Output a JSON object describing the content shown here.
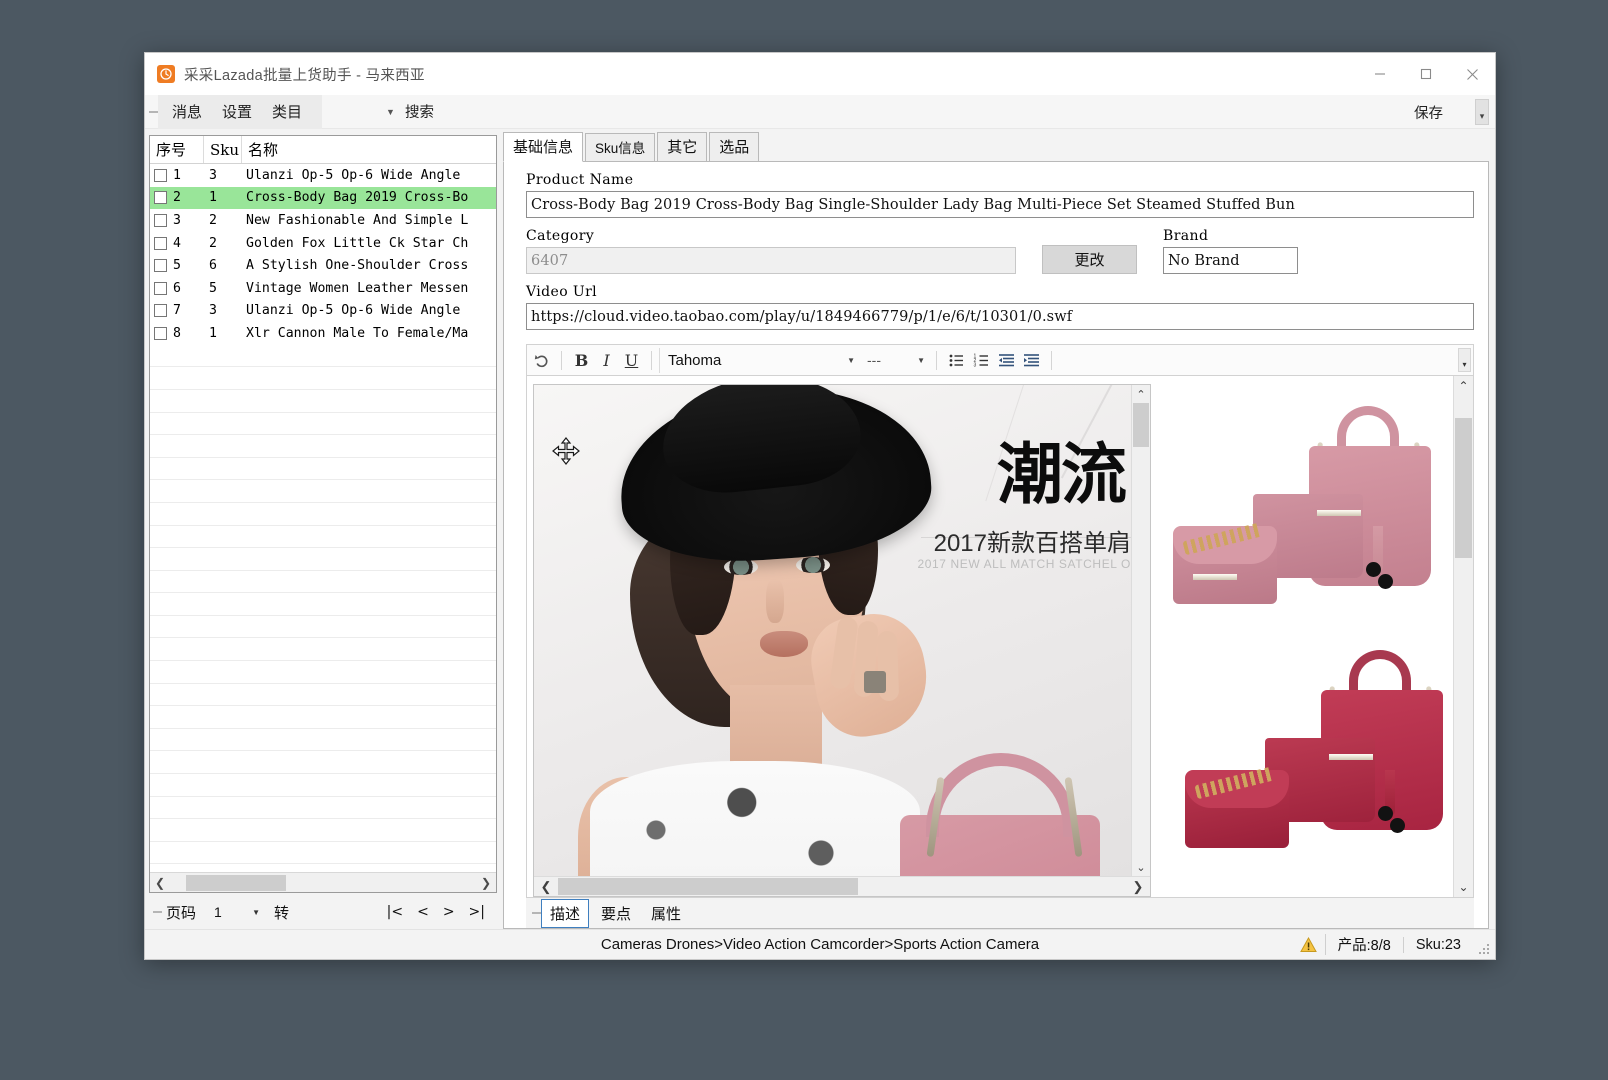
{
  "window": {
    "title": "采采Lazada批量上货助手 - 马来西亚",
    "app_icon": "app-logo-icon",
    "controls": {
      "minimize": "minimize-icon",
      "maximize": "maximize-icon",
      "close": "close-icon"
    }
  },
  "menubar": {
    "items": [
      "消息",
      "设置",
      "类目"
    ],
    "search_label": "搜索",
    "save_label": "保存"
  },
  "grid": {
    "columns": [
      "序号",
      "Sku",
      "名称"
    ],
    "rows": [
      {
        "index": "1",
        "sku": "3",
        "name": "Ulanzi Op-5 Op-6 Wide Angle",
        "selected": false
      },
      {
        "index": "2",
        "sku": "1",
        "name": "Cross-Body Bag 2019 Cross-Bo",
        "selected": true
      },
      {
        "index": "3",
        "sku": "2",
        "name": "New Fashionable And Simple L",
        "selected": false
      },
      {
        "index": "4",
        "sku": "2",
        "name": "Golden Fox Little Ck Star Ch",
        "selected": false
      },
      {
        "index": "5",
        "sku": "6",
        "name": "A Stylish One-Shoulder Cross",
        "selected": false
      },
      {
        "index": "6",
        "sku": "5",
        "name": "Vintage Women Leather Messen",
        "selected": false
      },
      {
        "index": "7",
        "sku": "3",
        "name": "Ulanzi Op-5 Op-6 Wide Angle",
        "selected": false
      },
      {
        "index": "8",
        "sku": "1",
        "name": "Xlr Cannon Male To Female/Ma",
        "selected": false
      }
    ]
  },
  "pager": {
    "label": "页码",
    "page_value": "1",
    "go_label": "转",
    "first": "|<",
    "prev": "<",
    "next": ">",
    "last": ">|"
  },
  "tabs": {
    "items": [
      {
        "label": "基础信息",
        "active": true
      },
      {
        "label": "Sku信息",
        "active": false
      },
      {
        "label": "其它",
        "active": false
      },
      {
        "label": "选品",
        "active": false
      }
    ]
  },
  "form": {
    "product_name_label": "Product Name",
    "product_name_value": "Cross-Body Bag 2019 Cross-Body Bag Single-Shoulder Lady Bag Multi-Piece Set Steamed Stuffed Bun",
    "category_label": "Category",
    "category_value": "6407",
    "change_button": "更改",
    "brand_label": "Brand",
    "brand_value": "No Brand",
    "video_url_label": "Video Url",
    "video_url_value": "https://cloud.video.taobao.com/play/u/1849466779/p/1/e/6/t/10301/0.swf"
  },
  "editor_toolbar": {
    "undo_icon": "undo-icon",
    "bold": "B",
    "italic": "I",
    "underline": "U",
    "font_name": "Tahoma",
    "font_size": "---",
    "bullet_list_icon": "bullet-list-icon",
    "numbered_list_icon": "numbered-list-icon",
    "indent_decrease_icon": "indent-decrease-icon",
    "indent_increase_icon": "indent-increase-icon",
    "overflow_icon": "chevron-down-icon"
  },
  "editor_content": {
    "hero_title": "潮流",
    "hero_sub": "2017新款百搭单肩",
    "hero_sub2": "2017 NEW ALL MATCH SATCHEL O",
    "move_cursor_icon": "move-cursor-icon"
  },
  "editor_bottom_tabs": [
    {
      "label": "描述",
      "active": true
    },
    {
      "label": "要点",
      "active": false
    },
    {
      "label": "属性",
      "active": false
    }
  ],
  "statusbar": {
    "breadcrumb": "Cameras Drones>Video Action Camcorder>Sports Action Camera",
    "warning_icon": "warning-icon",
    "product_count": "产品:8/8",
    "sku_count": "Sku:23"
  },
  "colors": {
    "selection_green": "#99e599",
    "accent_orange": "#ef7c23",
    "active_tab_border": "#3f7fbf"
  }
}
